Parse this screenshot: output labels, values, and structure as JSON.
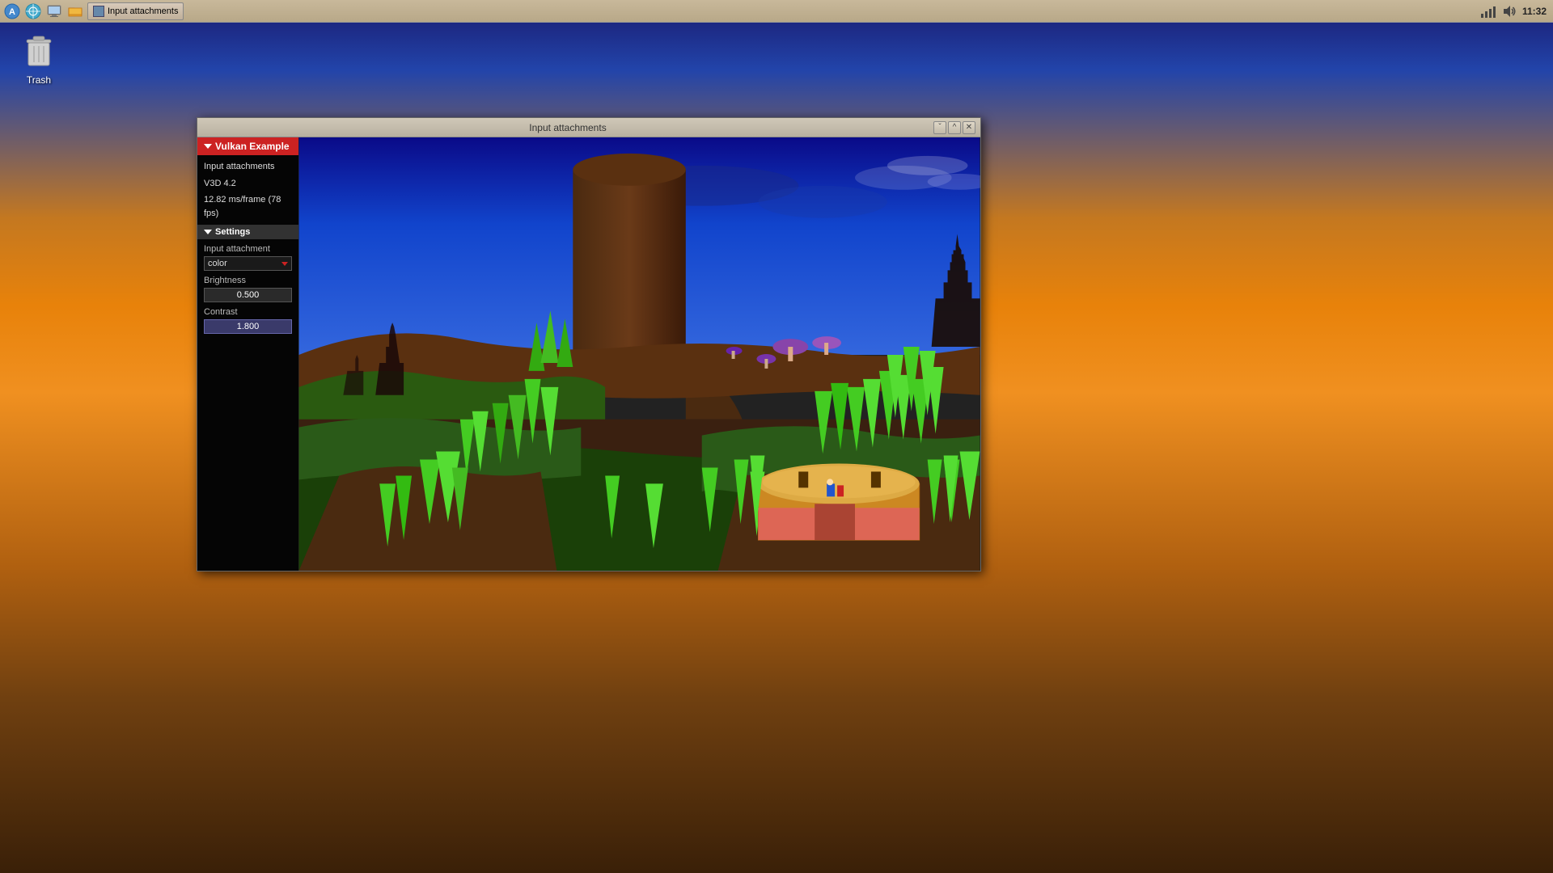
{
  "desktop": {
    "background": "sunset"
  },
  "taskbar": {
    "icons": [
      {
        "name": "network-icon",
        "label": "Network"
      },
      {
        "name": "sound-icon",
        "label": "Sound"
      },
      {
        "name": "monitor-icon",
        "label": "Monitor"
      },
      {
        "name": "folder-icon",
        "label": "Files"
      }
    ],
    "window_button": "Input attachments",
    "time": "11:32"
  },
  "desktop_icons": [
    {
      "id": "trash",
      "label": "Trash",
      "icon": "trash-icon"
    }
  ],
  "app_window": {
    "title": "Input attachments",
    "controls": {
      "minimize": "ˇ",
      "maximize": "^",
      "close": "✕"
    },
    "panel": {
      "header": "Vulkan Example",
      "lines": [
        "Input attachments",
        "V3D 4.2",
        "12.82 ms/frame (78 fps)"
      ],
      "settings_section": "Settings",
      "input_attachment_label": "Input attachment",
      "input_attachment_value": "color",
      "brightness_label": "Brightness",
      "brightness_value": "0.500",
      "contrast_label": "Contrast",
      "contrast_value": "1.800"
    }
  }
}
